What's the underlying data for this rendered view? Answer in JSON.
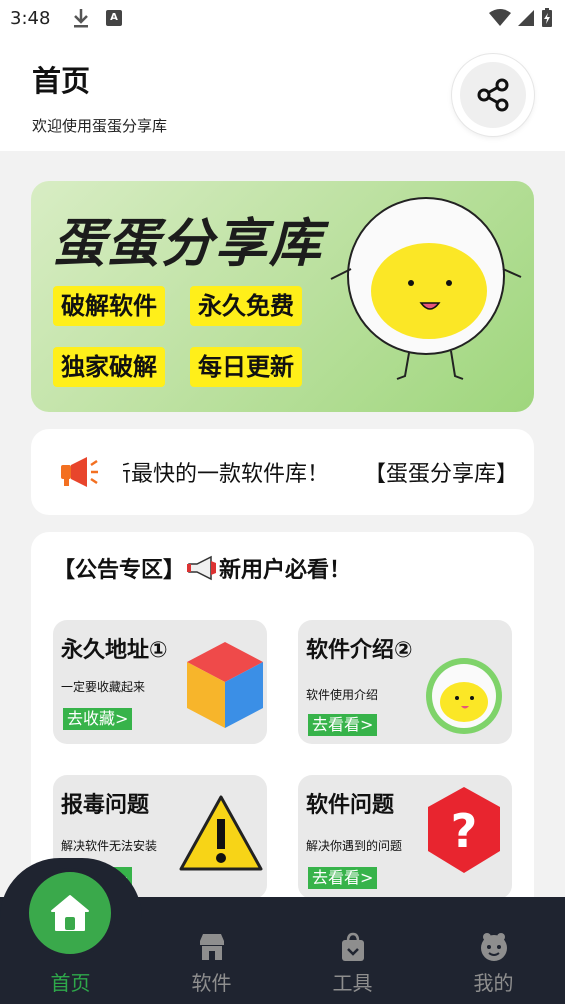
{
  "status_bar": {
    "time": "3:48",
    "a_badge": "A"
  },
  "header": {
    "title": "首页",
    "subtitle": "欢迎使用蛋蛋分享库"
  },
  "banner": {
    "title": "蛋蛋分享库",
    "tags": [
      "破解软件",
      "永久免费",
      "独家破解",
      "每日更新"
    ]
  },
  "marquee": {
    "text": "新最快的一款软件库！     【蛋蛋分享库】"
  },
  "announcement": {
    "heading_prefix": "【公告专区】",
    "heading_suffix": "新用户必看！",
    "tiles": [
      {
        "title": "永久地址①",
        "subtitle": "一定要收藏起来",
        "button": "去收藏>"
      },
      {
        "title": "软件介绍②",
        "subtitle": "软件使用介绍",
        "button": "去看看>"
      },
      {
        "title": "报毒问题",
        "subtitle": "解决软件无法安装",
        "button": "去看看>"
      },
      {
        "title": "软件问题",
        "subtitle": "解决你遇到的问题",
        "button": "去看看>"
      }
    ]
  },
  "bottom_nav": {
    "items": [
      {
        "label": "首页",
        "icon": "home-icon",
        "active": true
      },
      {
        "label": "软件",
        "icon": "store-icon",
        "active": false
      },
      {
        "label": "工具",
        "icon": "bag-icon",
        "active": false
      },
      {
        "label": "我的",
        "icon": "user-icon",
        "active": false
      }
    ]
  },
  "colors": {
    "accent_green": "#3aa94b",
    "nav_bg": "#1f2430",
    "tag_yellow": "#ffef1a"
  }
}
